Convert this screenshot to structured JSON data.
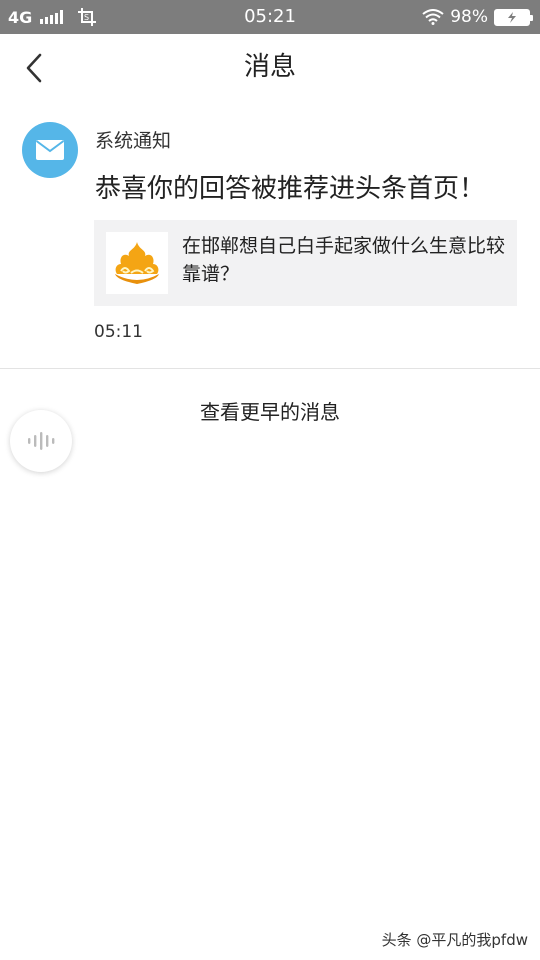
{
  "status_bar": {
    "network": "4G",
    "time": "05:21",
    "battery_percent": "98%",
    "battery_level": 0.98
  },
  "nav": {
    "title": "消息"
  },
  "notification": {
    "sender": "系统通知",
    "message": "恭喜你的回答被推荐进头条首页！",
    "card_text": "在邯郸想自己白手起家做什么生意比较靠谱？",
    "time": "05:11"
  },
  "earlier_link": "查看更早的消息",
  "watermark": "头条 @平凡的我pfdw",
  "colors": {
    "status_bar_bg": "#7d7d7d",
    "avatar_bg": "#55b6e8",
    "card_bg": "#f2f2f3",
    "thumb_accent": "#f4a514"
  },
  "icons": {
    "back": "chevron-left-icon",
    "avatar": "mail-icon",
    "voice": "voice-wave-icon",
    "wifi": "wifi-icon",
    "screenshot": "crop-icon"
  }
}
